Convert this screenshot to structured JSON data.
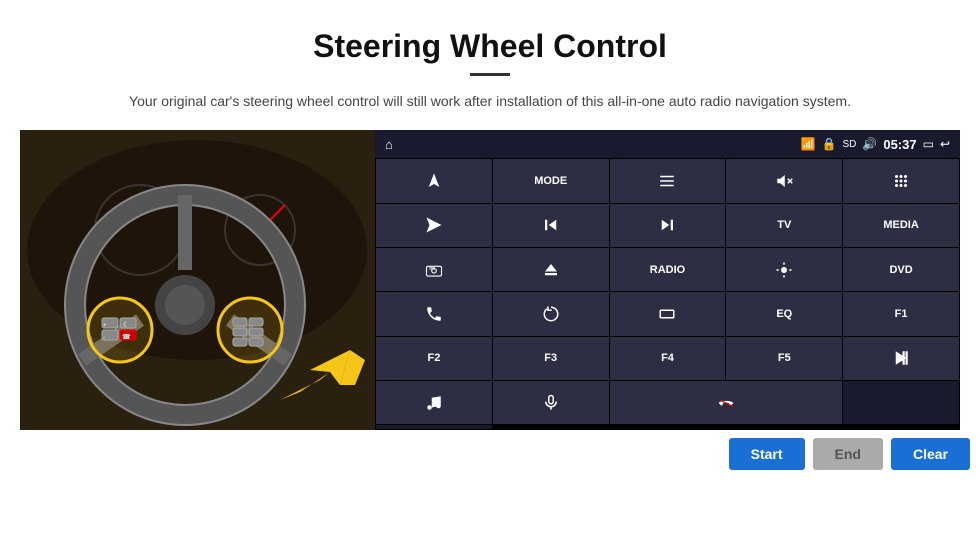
{
  "header": {
    "title": "Steering Wheel Control",
    "subtitle": "Your original car's steering wheel control will still work after installation of this all-in-one auto radio navigation system."
  },
  "status_bar": {
    "time": "05:37",
    "icons": [
      "wifi",
      "lock",
      "sd",
      "bluetooth",
      "screen",
      "back"
    ]
  },
  "grid_buttons": [
    {
      "id": "nav",
      "type": "icon",
      "icon": "nav"
    },
    {
      "id": "mode",
      "type": "text",
      "label": "MODE"
    },
    {
      "id": "list",
      "type": "icon",
      "icon": "list"
    },
    {
      "id": "mute",
      "type": "icon",
      "icon": "mute"
    },
    {
      "id": "apps",
      "type": "icon",
      "icon": "apps"
    },
    {
      "id": "arrow",
      "type": "icon",
      "icon": "send"
    },
    {
      "id": "prev",
      "type": "icon",
      "icon": "prev"
    },
    {
      "id": "next",
      "type": "icon",
      "icon": "next"
    },
    {
      "id": "tv",
      "type": "text",
      "label": "TV"
    },
    {
      "id": "media",
      "type": "text",
      "label": "MEDIA"
    },
    {
      "id": "cam360",
      "type": "icon",
      "icon": "360"
    },
    {
      "id": "eject",
      "type": "icon",
      "icon": "eject"
    },
    {
      "id": "radio",
      "type": "text",
      "label": "RADIO"
    },
    {
      "id": "brightness",
      "type": "icon",
      "icon": "brightness"
    },
    {
      "id": "dvd",
      "type": "text",
      "label": "DVD"
    },
    {
      "id": "phone",
      "type": "icon",
      "icon": "phone"
    },
    {
      "id": "swirl",
      "type": "icon",
      "icon": "swirl"
    },
    {
      "id": "rect",
      "type": "icon",
      "icon": "rect"
    },
    {
      "id": "eq",
      "type": "text",
      "label": "EQ"
    },
    {
      "id": "f1",
      "type": "text",
      "label": "F1"
    },
    {
      "id": "f2",
      "type": "text",
      "label": "F2"
    },
    {
      "id": "f3",
      "type": "text",
      "label": "F3"
    },
    {
      "id": "f4",
      "type": "text",
      "label": "F4"
    },
    {
      "id": "f5",
      "type": "text",
      "label": "F5"
    },
    {
      "id": "playpause",
      "type": "icon",
      "icon": "playpause"
    },
    {
      "id": "music",
      "type": "icon",
      "icon": "music"
    },
    {
      "id": "mic",
      "type": "icon",
      "icon": "mic"
    },
    {
      "id": "callend",
      "type": "icon",
      "icon": "callend"
    },
    {
      "id": "empty1",
      "type": "empty"
    },
    {
      "id": "empty2",
      "type": "empty"
    }
  ],
  "actions": {
    "start_label": "Start",
    "end_label": "End",
    "clear_label": "Clear"
  }
}
